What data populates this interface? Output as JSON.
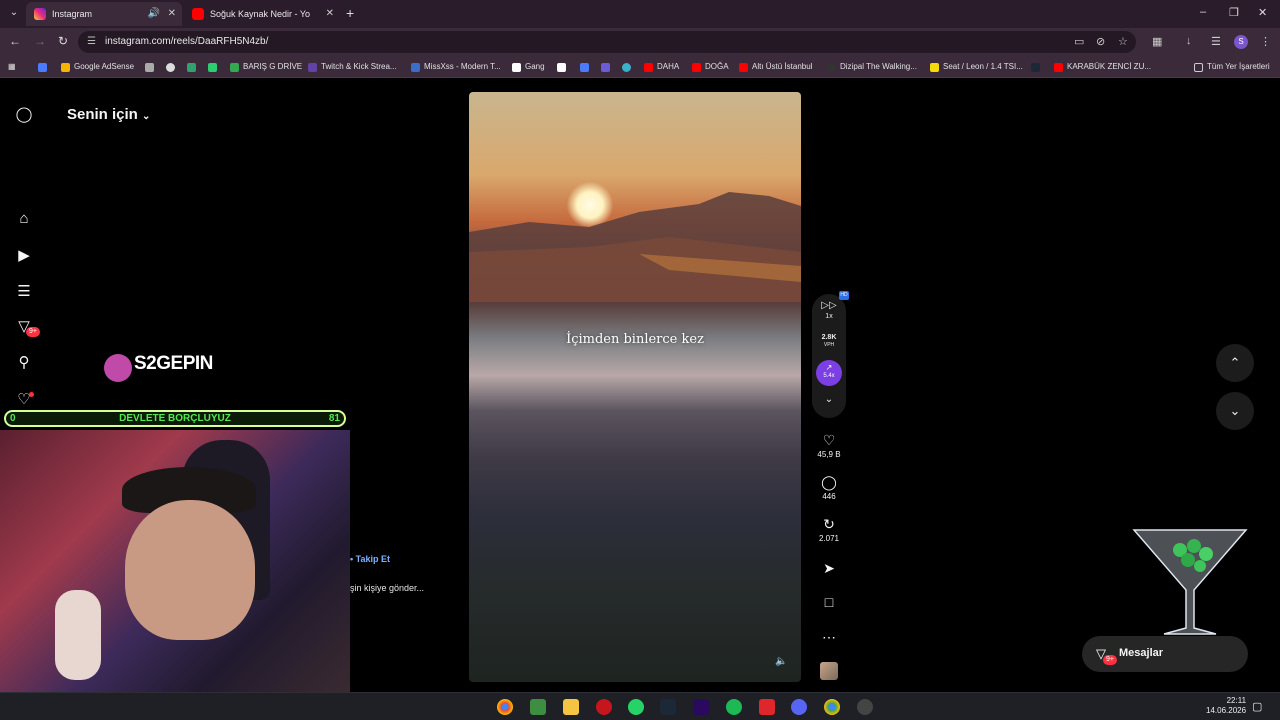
{
  "browser": {
    "tabs": [
      {
        "title": "Instagram",
        "active": true,
        "icon": "instagram-icon"
      },
      {
        "title": "Soğuk Kaynak Nedir - YouTube",
        "active": false,
        "icon": "youtube-icon"
      }
    ],
    "url": "instagram.com/reels/DaaRFH5N4zb/",
    "bookmarks": [
      "Google AdSense",
      "BARIŞ G DRİVE",
      "Twitch & Kick Strea...",
      "MissXss - Modern T...",
      "Gang",
      "DAHA",
      "DOĞA",
      "Altı Üstü İstanbul",
      "Dizipal The Walking...",
      "Seat / Leon / 1.4 TSI...",
      "KARABÜK ZENCİ ZU...",
      "Tüm Yer İşaretleri"
    ],
    "profile_initial": "S"
  },
  "sidebar": {
    "badges": {
      "filter": "9+"
    }
  },
  "feed": {
    "title": "Senin için"
  },
  "reel": {
    "caption": "İçimden binlerce kez"
  },
  "speed_panel": {
    "speed": "1x",
    "vph": "2.8K",
    "vph_label": "VPH",
    "trend": "5.4x",
    "hq_badge": "HD"
  },
  "actions": {
    "likes": "45,9 B",
    "comments": "446",
    "reposts": "2.071"
  },
  "messages": {
    "label": "Mesajlar",
    "badge": "9+"
  },
  "overlay": {
    "logo": "S2GEPIN",
    "goal_label": "DEVLETE BORÇLUYUZ",
    "goal_min": "0",
    "goal_max": "81",
    "follow_text": "• Takip Et",
    "send_text": "şin kişiye gönder..."
  },
  "taskbar": {
    "time": "22:11",
    "date": "14.06.2026"
  }
}
